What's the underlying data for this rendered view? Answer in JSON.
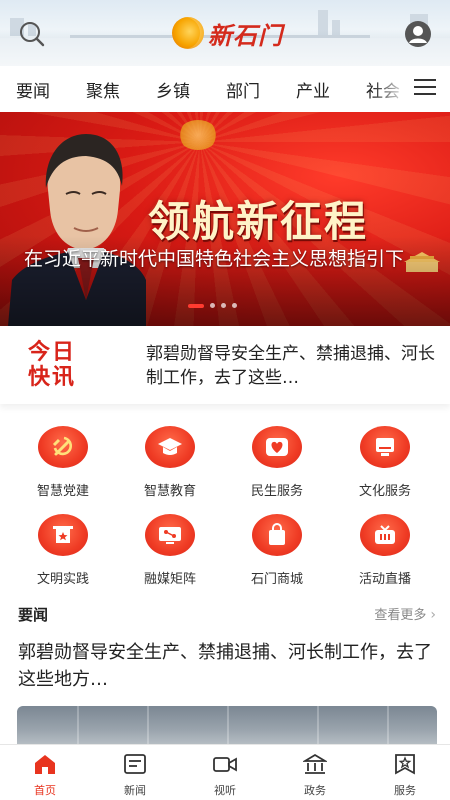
{
  "header": {
    "logo_text": "新石门",
    "search_icon": "search-icon",
    "avatar_icon": "user-avatar-icon"
  },
  "tabs": [
    {
      "label": "要闻"
    },
    {
      "label": "聚焦"
    },
    {
      "label": "乡镇"
    },
    {
      "label": "部门"
    },
    {
      "label": "产业"
    },
    {
      "label": "社会"
    }
  ],
  "banner": {
    "slogan": "领航新征程",
    "caption": "在习近平新时代中国特色社会主义思想指引下",
    "page_count": 4,
    "active_page": 1
  },
  "flash": {
    "title_line1": "今日",
    "title_line2": "快讯",
    "text": "郭碧勋督导安全生产、禁捕退捕、河长制工作，去了这些…"
  },
  "grid": [
    {
      "label": "智慧党建",
      "icon": "party-emblem-icon"
    },
    {
      "label": "智慧教育",
      "icon": "graduation-cap-icon"
    },
    {
      "label": "民生服务",
      "icon": "heart-icon"
    },
    {
      "label": "文化服务",
      "icon": "monitor-icon"
    },
    {
      "label": "文明实践",
      "icon": "star-banner-icon"
    },
    {
      "label": "融媒矩阵",
      "icon": "media-matrix-icon"
    },
    {
      "label": "石门商城",
      "icon": "shopping-bag-icon"
    },
    {
      "label": "活动直播",
      "icon": "live-tv-icon"
    }
  ],
  "section": {
    "title": "要闻",
    "more": "查看更多"
  },
  "article": {
    "title": "郭碧勋督导安全生产、禁捕退捕、河长制工作，去了这些地方…"
  },
  "bottom_nav": [
    {
      "label": "首页",
      "icon": "home-icon",
      "active": true
    },
    {
      "label": "新闻",
      "icon": "news-icon",
      "active": false
    },
    {
      "label": "视听",
      "icon": "video-camera-icon",
      "active": false
    },
    {
      "label": "政务",
      "icon": "government-building-icon",
      "active": false
    },
    {
      "label": "服务",
      "icon": "service-star-icon",
      "active": false
    }
  ],
  "colors": {
    "accent": "#e8341f",
    "flash_red": "#d8241a",
    "banner_red": "#d91a14"
  }
}
